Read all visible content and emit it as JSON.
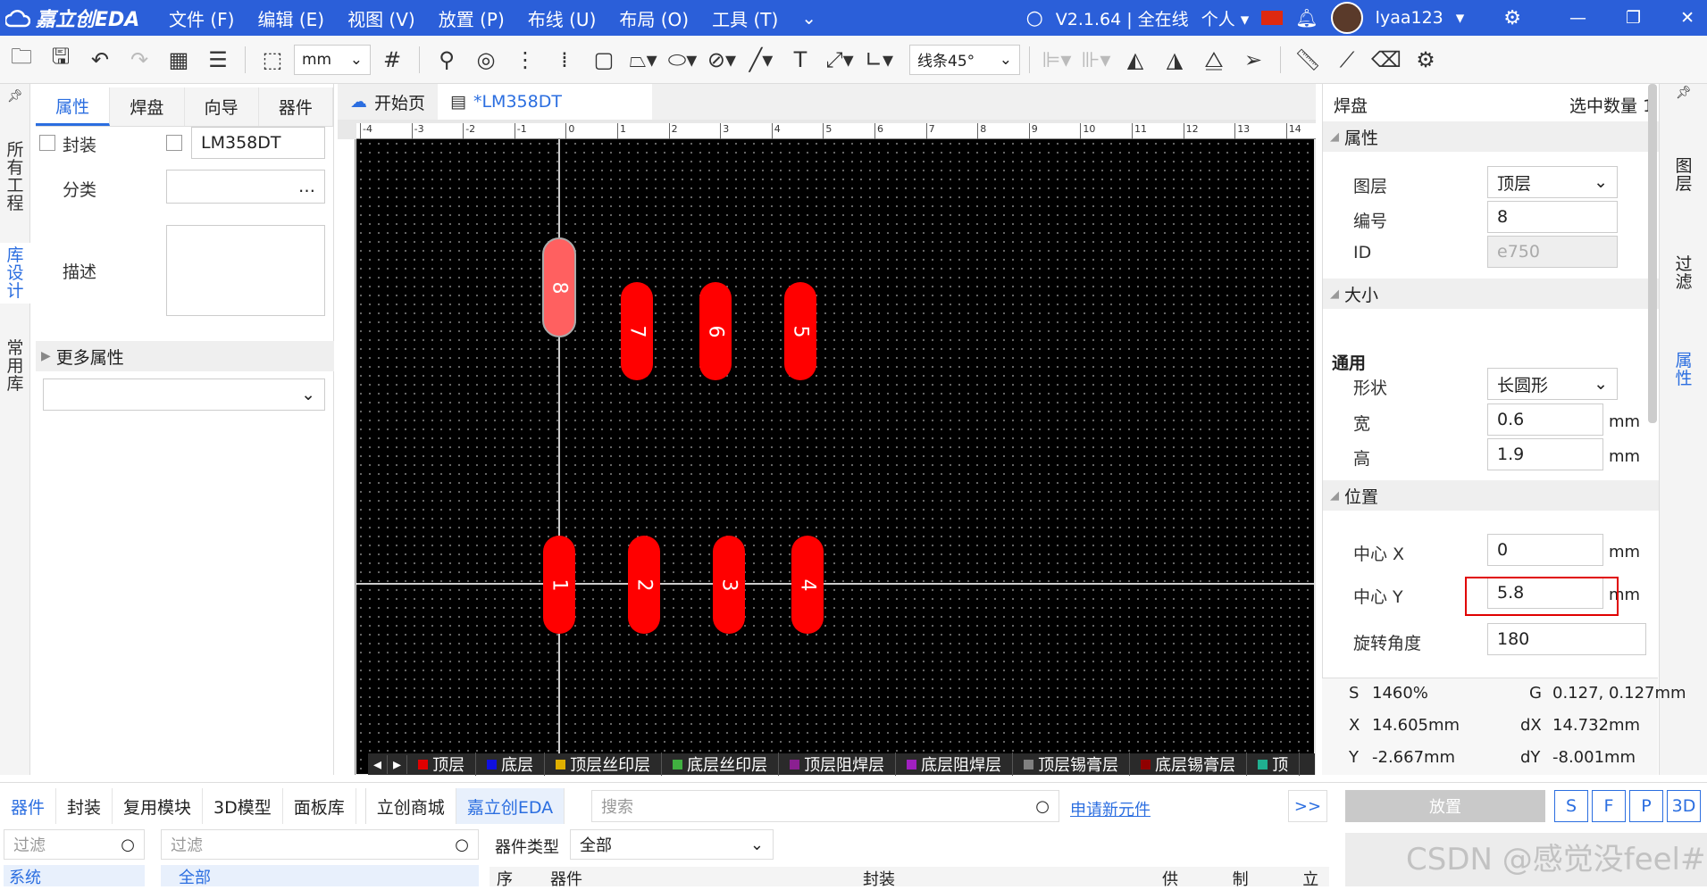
{
  "app": {
    "logo": "嘉立创EDA",
    "version": "V2.1.64 | 全在线",
    "mode": "个人",
    "user": "lyaa123"
  },
  "menu": [
    "文件 (F)",
    "编辑 (E)",
    "视图 (V)",
    "放置 (P)",
    "布线 (U)",
    "布局 (O)",
    "工具 (T)"
  ],
  "toolbar": {
    "unit": "mm",
    "route_mode": "线条45°"
  },
  "left_strip": [
    "所有工程",
    "库设计",
    "常用库"
  ],
  "left_panel": {
    "tabs": [
      "属性",
      "焊盘",
      "向导",
      "器件"
    ],
    "footprint_label": "封装",
    "footprint_value": "LM358DT",
    "category_label": "分类",
    "category_value": "…",
    "desc_label": "描述",
    "more_label": "更多属性"
  },
  "doc_tabs": [
    "开始页",
    "*LM358DT"
  ],
  "ruler_top": [
    "-4",
    "-3",
    "-2",
    "-1",
    "0",
    "1",
    "2",
    "3",
    "4",
    "5",
    "6",
    "7",
    "8",
    "9",
    "10",
    "11",
    "12",
    "13",
    "14"
  ],
  "pads_top": [
    "8",
    "7",
    "6",
    "5"
  ],
  "pads_bottom": [
    "1",
    "2",
    "3",
    "4"
  ],
  "layers": [
    {
      "name": "顶层",
      "color": "#e00000"
    },
    {
      "name": "底层",
      "color": "#1010e0"
    },
    {
      "name": "顶层丝印层",
      "color": "#e0b000"
    },
    {
      "name": "底层丝印层",
      "color": "#40b040"
    },
    {
      "name": "顶层阻焊层",
      "color": "#8a2090"
    },
    {
      "name": "底层阻焊层",
      "color": "#a020c0"
    },
    {
      "name": "顶层锡膏层",
      "color": "#808080"
    },
    {
      "name": "底层锡膏层",
      "color": "#900000"
    },
    {
      "name": "顶",
      "color": "#20b090"
    }
  ],
  "right_panel": {
    "title": "焊盘",
    "selected_label": "选中数量",
    "selected_count": "1",
    "sec_props": "属性",
    "layer_label": "图层",
    "layer_value": "顶层",
    "number_label": "编号",
    "number_value": "8",
    "id_label": "ID",
    "id_value": "e750",
    "sec_size": "大小",
    "general": "通用",
    "shape_label": "形状",
    "shape_value": "长圆形",
    "width_label": "宽",
    "width_value": "0.6",
    "height_label": "高",
    "height_value": "1.9",
    "unit": "mm",
    "sec_pos": "位置",
    "cx_label": "中心 X",
    "cx_value": "0",
    "cy_label": "中心 Y",
    "cy_value": "5.8",
    "rot_label": "旋转角度",
    "rot_value": "180"
  },
  "right_strip": [
    "图层",
    "过滤",
    "属性"
  ],
  "status": {
    "s_label": "S",
    "s_value": "1460%",
    "g_label": "G",
    "g_value": "0.127, 0.127mm",
    "x_label": "X",
    "x_value": "14.605mm",
    "dx_label": "dX",
    "dx_value": "14.732mm",
    "y_label": "Y",
    "y_value": "-2.667mm",
    "dy_label": "dY",
    "dy_value": "-8.001mm"
  },
  "bottom": {
    "tabs": [
      "器件",
      "封装",
      "复用模块",
      "3D模型",
      "面板库",
      "立创商城",
      "嘉立创EDA"
    ],
    "search_placeholder": "搜索",
    "new_part": "申请新元件",
    "expand": ">>",
    "filter1": "过滤",
    "filter2": "过滤",
    "type_label": "器件类型",
    "type_value": "全部",
    "tree_item": "系统",
    "list_item": "全部",
    "cols": [
      "序",
      "器件",
      "封装",
      "供",
      "制",
      "立"
    ],
    "place": "放置",
    "btns": [
      "S",
      "F",
      "P",
      "3D"
    ],
    "watermark": "CSDN @感觉没feel#"
  }
}
